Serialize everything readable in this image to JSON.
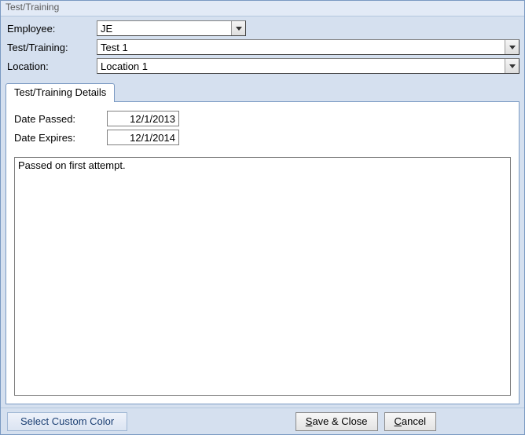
{
  "window": {
    "title": "Test/Training"
  },
  "header": {
    "employee_label": "Employee:",
    "employee_value": "JE",
    "test_label": "Test/Training:",
    "test_value": "Test 1",
    "location_label": "Location:",
    "location_value": "Location 1"
  },
  "tab": {
    "label": "Test/Training Details"
  },
  "details": {
    "date_passed_label": "Date Passed:",
    "date_passed_value": "12/1/2013",
    "date_expires_label": "Date Expires:",
    "date_expires_value": "12/1/2014",
    "notes": "Passed on first attempt."
  },
  "footer": {
    "custom_color": "Select Custom Color",
    "save_prefix": "S",
    "save_suffix": "ave & Close",
    "cancel_prefix": "C",
    "cancel_suffix": "ancel"
  }
}
